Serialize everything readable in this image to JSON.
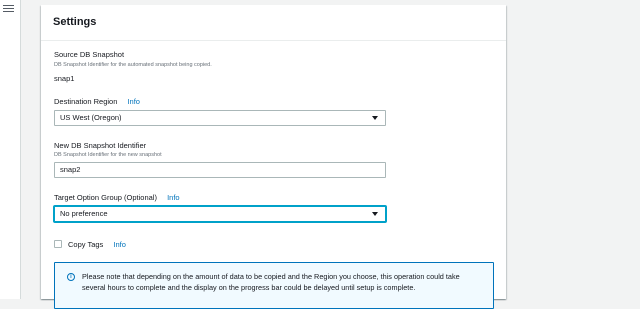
{
  "nav": {
    "menu_icon": "hamburger-menu-icon"
  },
  "settings": {
    "title": "Settings",
    "source_snapshot": {
      "label": "Source DB Snapshot",
      "description": "DB Snapshot Identifier for the automated snapshot being copied.",
      "value": "snap1"
    },
    "destination_region": {
      "label": "Destination Region",
      "info": "Info",
      "selected": "US West (Oregon)"
    },
    "new_snapshot": {
      "label": "New DB Snapshot Identifier",
      "description": "DB Snapshot Identifier for the new snapshot",
      "value": "snap2"
    },
    "target_option_group": {
      "label": "Target Option Group (Optional)",
      "info": "Info",
      "selected": "No preference"
    },
    "copy_tags": {
      "label": "Copy Tags",
      "info": "Info",
      "checked": false
    },
    "alert": {
      "icon": "info-circle-icon",
      "text": "Please note that depending on the amount of data to be copied and the Region you choose, this operation could take several hours to complete and the display on the progress bar could be delayed until setup is complete."
    }
  },
  "colors": {
    "background": "#f2f3f3",
    "link": "#0073bb",
    "focus": "#00a1c9",
    "alert_bg": "#f1faff"
  }
}
